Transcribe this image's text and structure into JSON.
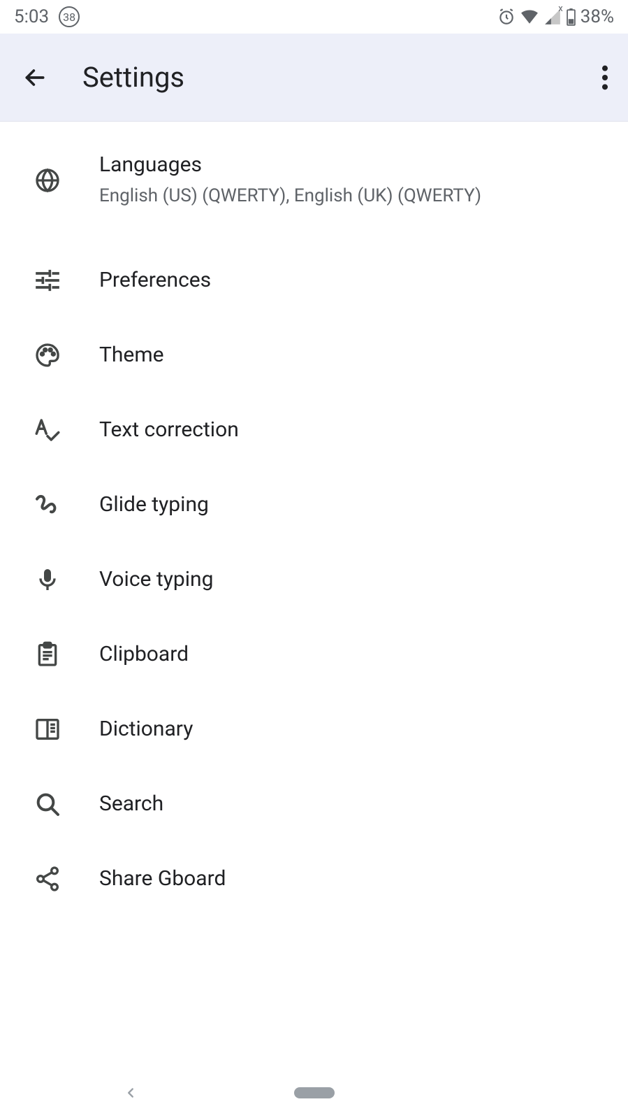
{
  "status": {
    "time": "5:03",
    "badge": "38",
    "battery": "38%"
  },
  "header": {
    "title": "Settings"
  },
  "items": [
    {
      "title": "Languages",
      "sub": "English (US) (QWERTY), English (UK) (QWERTY)"
    },
    {
      "title": "Preferences"
    },
    {
      "title": "Theme"
    },
    {
      "title": "Text correction"
    },
    {
      "title": "Glide typing"
    },
    {
      "title": "Voice typing"
    },
    {
      "title": "Clipboard"
    },
    {
      "title": "Dictionary"
    },
    {
      "title": "Search"
    },
    {
      "title": "Share Gboard"
    }
  ]
}
